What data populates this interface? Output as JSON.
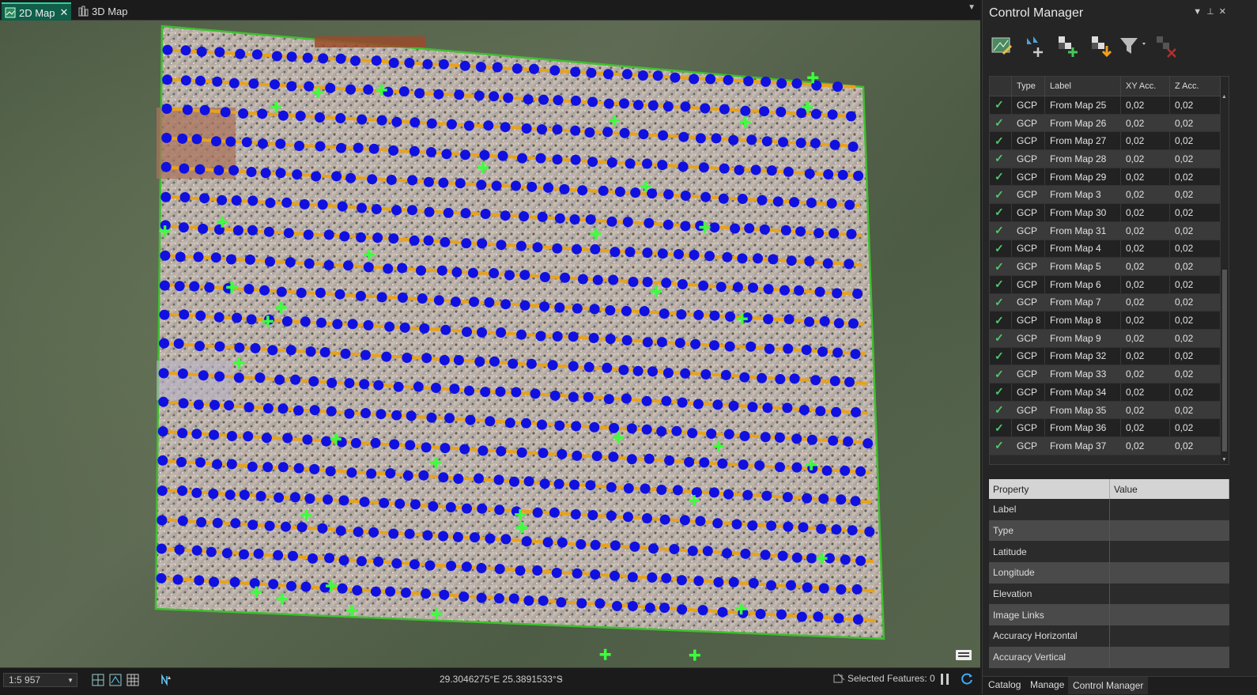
{
  "map_tabs": [
    {
      "label": "2D Map",
      "close": "✕"
    },
    {
      "label": "3D Map"
    }
  ],
  "status": {
    "scale": "1:5 957",
    "coordinates": "29.3046275°E 25.3891533°S",
    "selected_features": "Selected Features: 0"
  },
  "panel": {
    "title": "Control Manager",
    "gcp_columns": [
      "",
      "Type",
      "Label",
      "XY Acc.",
      "Z Acc."
    ],
    "gcp_rows": [
      {
        "type": "GCP",
        "label": "From Map 25",
        "xy": "0,02",
        "z": "0,02"
      },
      {
        "type": "GCP",
        "label": "From Map 26",
        "xy": "0,02",
        "z": "0,02"
      },
      {
        "type": "GCP",
        "label": "From Map 27",
        "xy": "0,02",
        "z": "0,02"
      },
      {
        "type": "GCP",
        "label": "From Map 28",
        "xy": "0,02",
        "z": "0,02"
      },
      {
        "type": "GCP",
        "label": "From Map 29",
        "xy": "0,02",
        "z": "0,02"
      },
      {
        "type": "GCP",
        "label": "From Map 3",
        "xy": "0,02",
        "z": "0,02"
      },
      {
        "type": "GCP",
        "label": "From Map 30",
        "xy": "0,02",
        "z": "0,02"
      },
      {
        "type": "GCP",
        "label": "From Map 31",
        "xy": "0,02",
        "z": "0,02"
      },
      {
        "type": "GCP",
        "label": "From Map 4",
        "xy": "0,02",
        "z": "0,02"
      },
      {
        "type": "GCP",
        "label": "From Map 5",
        "xy": "0,02",
        "z": "0,02"
      },
      {
        "type": "GCP",
        "label": "From Map 6",
        "xy": "0,02",
        "z": "0,02"
      },
      {
        "type": "GCP",
        "label": "From Map 7",
        "xy": "0,02",
        "z": "0,02"
      },
      {
        "type": "GCP",
        "label": "From Map 8",
        "xy": "0,02",
        "z": "0,02"
      },
      {
        "type": "GCP",
        "label": "From Map 9",
        "xy": "0,02",
        "z": "0,02"
      },
      {
        "type": "GCP",
        "label": "From Map 32",
        "xy": "0,02",
        "z": "0,02"
      },
      {
        "type": "GCP",
        "label": "From Map 33",
        "xy": "0,02",
        "z": "0,02"
      },
      {
        "type": "GCP",
        "label": "From Map 34",
        "xy": "0,02",
        "z": "0,02"
      },
      {
        "type": "GCP",
        "label": "From Map 35",
        "xy": "0,02",
        "z": "0,02"
      },
      {
        "type": "GCP",
        "label": "From Map 36",
        "xy": "0,02",
        "z": "0,02"
      },
      {
        "type": "GCP",
        "label": "From Map 37",
        "xy": "0,02",
        "z": "0,02"
      }
    ],
    "property_header": {
      "property": "Property",
      "value": "Value"
    },
    "properties": [
      "Label",
      "Type",
      "Latitude",
      "Longitude",
      "Elevation",
      "Image Links",
      "Accuracy Horizontal",
      "Accuracy Vertical"
    ],
    "bottom_tabs": [
      "Catalog",
      "Manage",
      "Control Manager"
    ]
  },
  "colors": {
    "accent_tab": "#0f5f4a",
    "footprint_outline": "#3fbf2f",
    "tie_point": "#1010e0",
    "flight_line": "#e8a21a",
    "gcp_marker": "#3cff3c",
    "check": "#4fc96d"
  }
}
